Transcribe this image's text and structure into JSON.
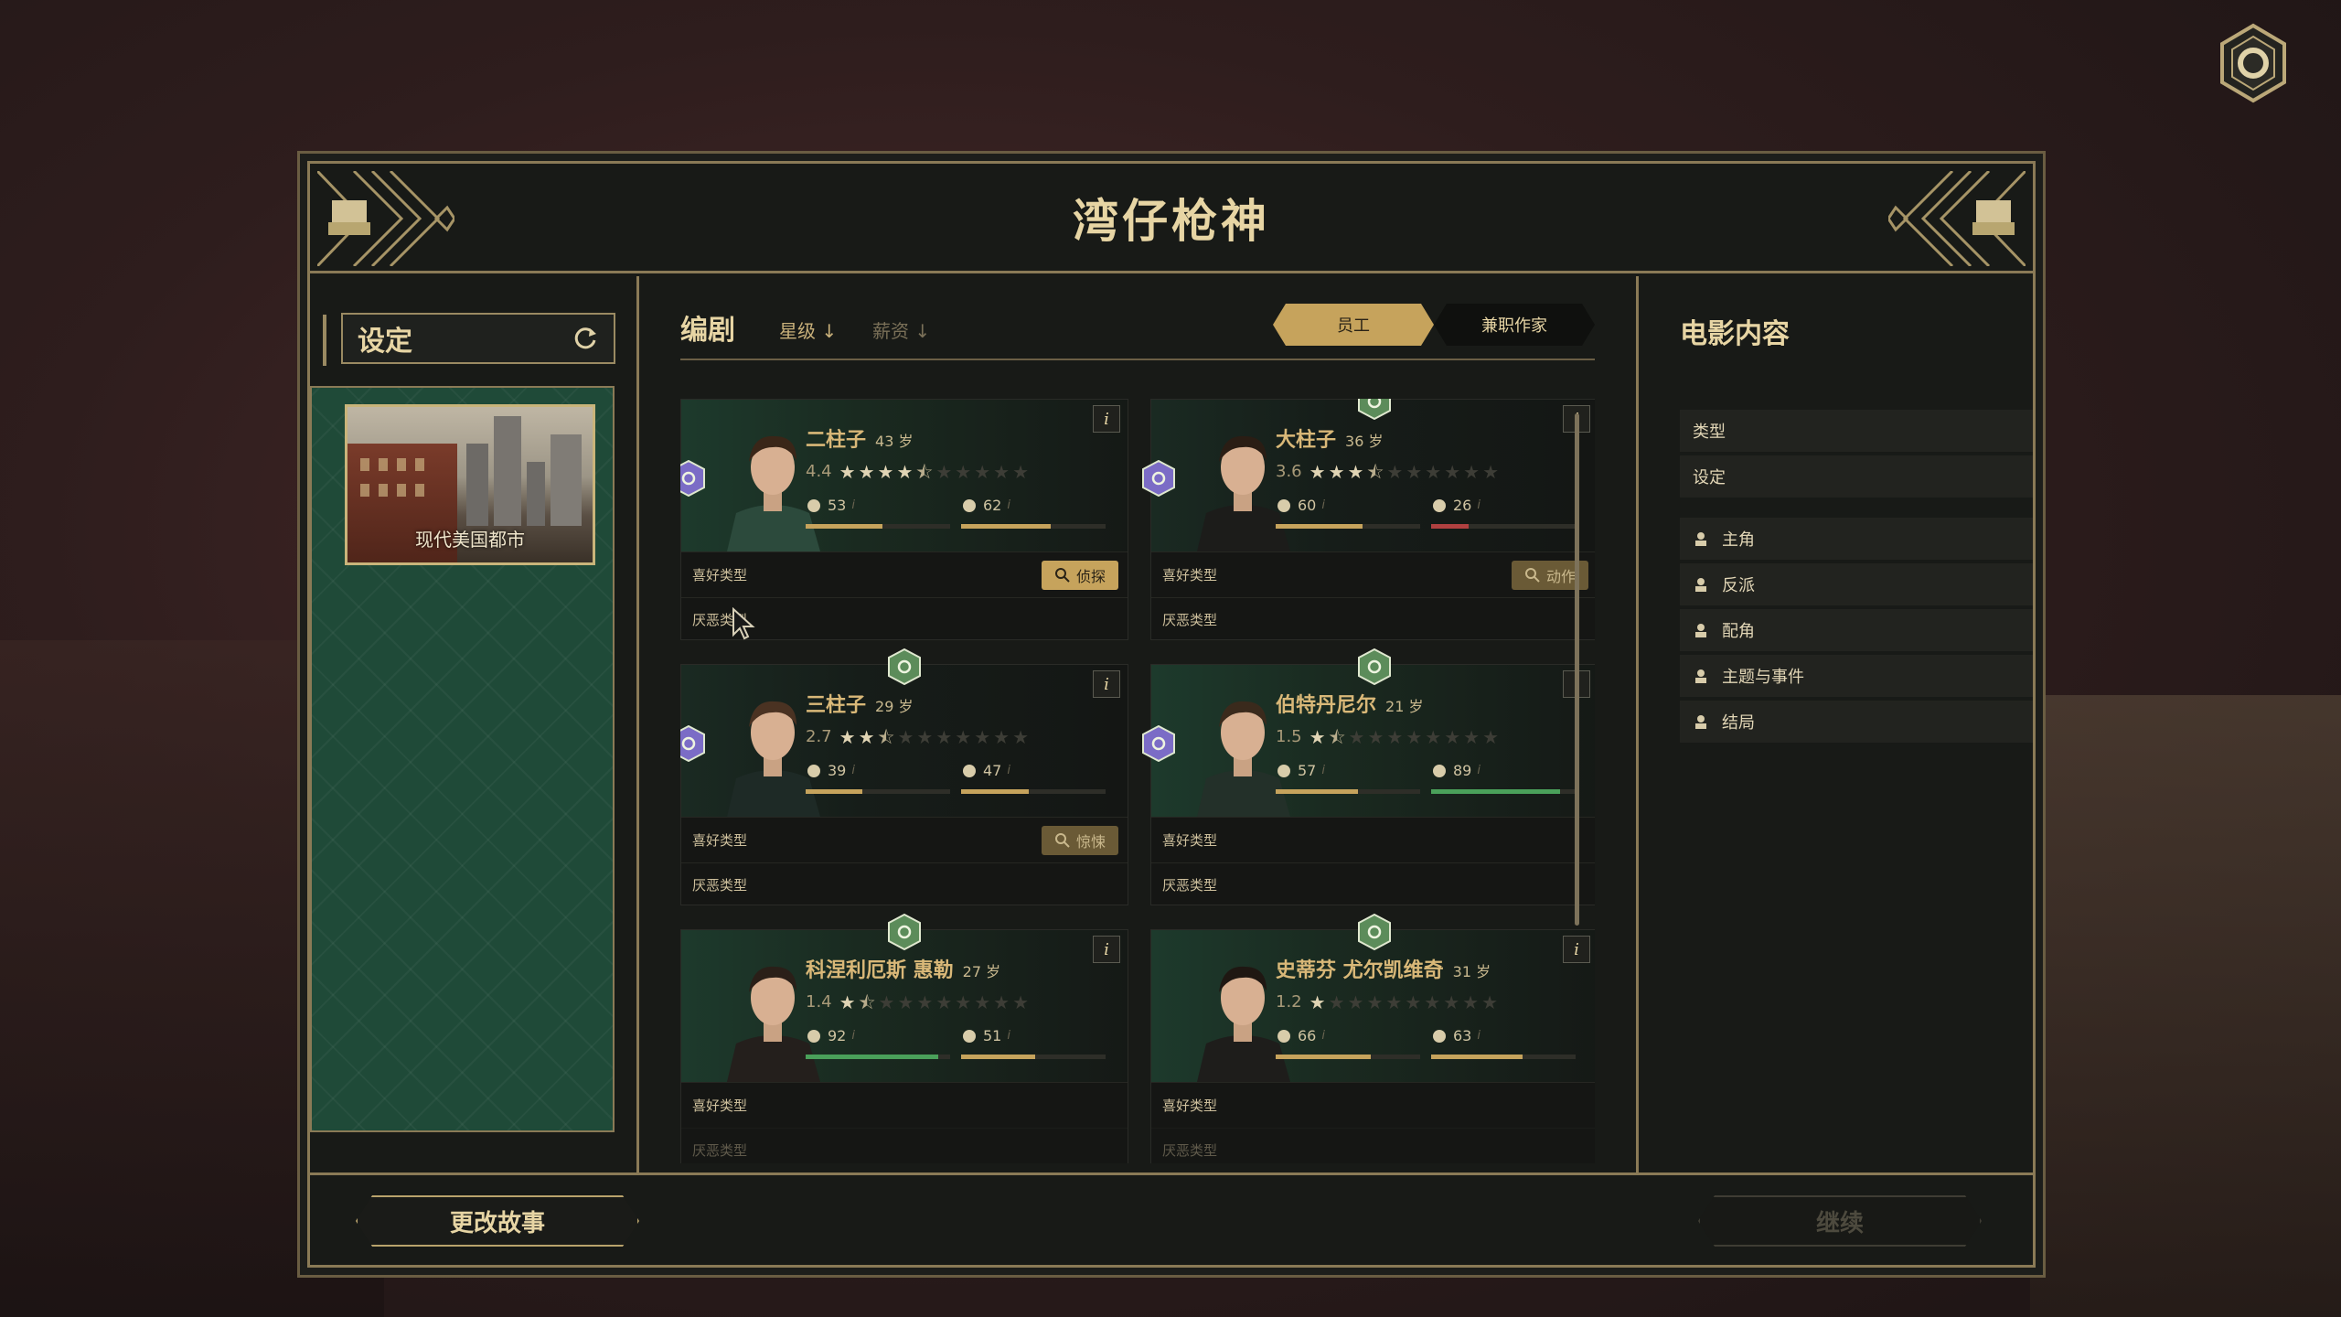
{
  "window": {
    "title": "湾仔枪神"
  },
  "left": {
    "header_label": "设定",
    "setting_card": {
      "name": "现代美国都市"
    }
  },
  "middle": {
    "tab_title": "编剧",
    "sort_star": "星级 ↓",
    "sort_pay": "薪资 ↓",
    "segment": {
      "staff": "员工",
      "freelance": "兼职作家",
      "active": "staff"
    },
    "like_label": "喜好类型",
    "dislike_label": "厌恶类型",
    "cards": [
      {
        "name": "二柱子",
        "age": "43 岁",
        "rating": "4.4",
        "rating_value": 4.4,
        "stat1": "53",
        "stat2": "62",
        "stat1_fill": 0.53,
        "stat2_fill": 0.62,
        "bar1_color": "#c6a35c",
        "bar2_color": "#c6a35c",
        "genre": "侦探",
        "genre_icon": "magnifier-icon",
        "side_badge_icon": "gear-icon",
        "top_badge": false,
        "dim": false
      },
      {
        "name": "大柱子",
        "age": "36 岁",
        "rating": "3.6",
        "rating_value": 3.6,
        "stat1": "60",
        "stat2": "26",
        "stat1_fill": 0.6,
        "stat2_fill": 0.26,
        "bar1_color": "#c6a35c",
        "bar2_color": "#b04040",
        "genre": "动作",
        "genre_icon": "action-icon",
        "side_badge_icon": "group-icon",
        "top_badge": true,
        "dim": true
      },
      {
        "name": "三柱子",
        "age": "29 岁",
        "rating": "2.7",
        "rating_value": 2.7,
        "stat1": "39",
        "stat2": "47",
        "stat1_fill": 0.39,
        "stat2_fill": 0.47,
        "bar1_color": "#c6a35c",
        "bar2_color": "#c6a35c",
        "genre": "惊悚",
        "genre_icon": "knife-icon",
        "side_badge_icon": "mask-icon",
        "top_badge": true,
        "dim": true
      },
      {
        "name": "伯特丹尼尔",
        "age": "21 岁",
        "rating": "1.5",
        "rating_value": 1.5,
        "stat1": "57",
        "stat2": "89",
        "stat1_fill": 0.57,
        "stat2_fill": 0.89,
        "bar1_color": "#c6a35c",
        "bar2_color": "#4aa05a",
        "genre": "",
        "genre_icon": "",
        "side_badge_icon": "fire-icon",
        "top_badge": true,
        "dim": false
      },
      {
        "name": "科涅利厄斯 惠勒",
        "age": "27 岁",
        "rating": "1.4",
        "rating_value": 1.4,
        "stat1": "92",
        "stat2": "51",
        "stat1_fill": 0.92,
        "stat2_fill": 0.51,
        "bar1_color": "#4aa05a",
        "bar2_color": "#c6a35c",
        "genre": "",
        "genre_icon": "",
        "side_badge_icon": "",
        "top_badge": true,
        "dim": false
      },
      {
        "name": "史蒂芬 尤尔凯维奇",
        "age": "31 岁",
        "rating": "1.2",
        "rating_value": 1.2,
        "stat1": "66",
        "stat2": "63",
        "stat1_fill": 0.66,
        "stat2_fill": 0.63,
        "bar1_color": "#c6a35c",
        "bar2_color": "#c6a35c",
        "genre": "",
        "genre_icon": "",
        "side_badge_icon": "",
        "top_badge": true,
        "dim": false
      }
    ]
  },
  "right": {
    "title": "电影内容",
    "items": [
      {
        "label": "类型",
        "icon": ""
      },
      {
        "label": "设定",
        "icon": ""
      },
      {
        "label": "主角",
        "icon": "person-icon"
      },
      {
        "label": "反派",
        "icon": "villain-icon"
      },
      {
        "label": "配角",
        "icon": "people-icon"
      },
      {
        "label": "主题与事件",
        "icon": "calendar-icon"
      },
      {
        "label": "结局",
        "icon": "checkered-flag-icon"
      }
    ]
  },
  "footer": {
    "change_story": "更改故事",
    "continue": "继续"
  },
  "colors": {
    "accent_gold": "#c6a35c",
    "panel_green": "#1f4a38",
    "frame_border": "#8a7a56"
  }
}
